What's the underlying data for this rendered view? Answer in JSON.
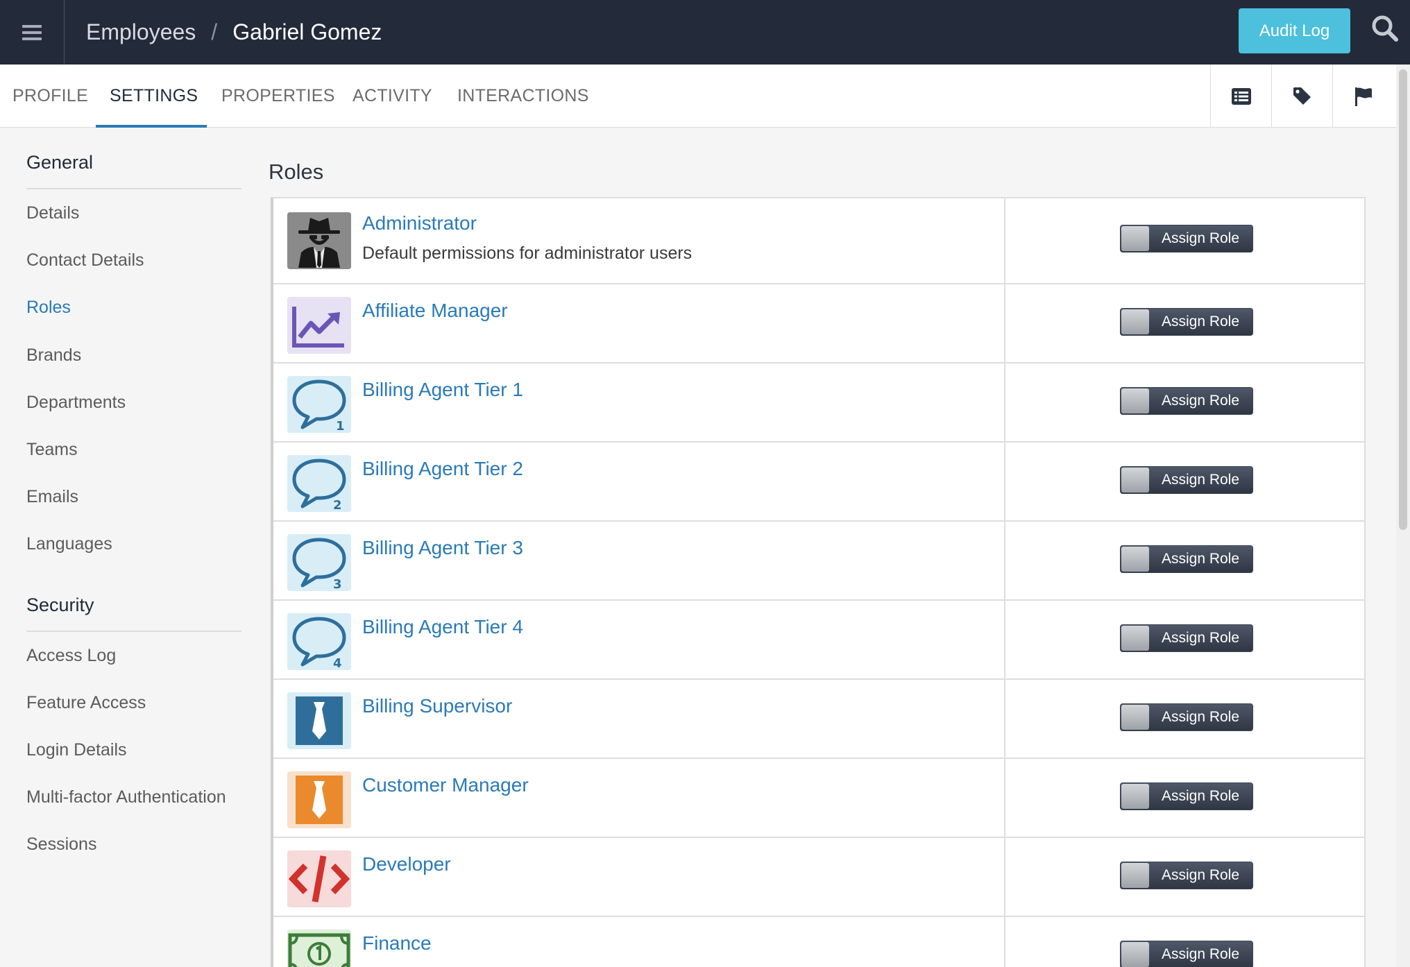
{
  "header": {
    "breadcrumb_parent": "Employees",
    "breadcrumb_separator": "/",
    "breadcrumb_current": "Gabriel Gomez",
    "audit_log_label": "Audit Log"
  },
  "tabs": [
    "PROFILE",
    "SETTINGS",
    "PROPERTIES",
    "ACTIVITY",
    "INTERACTIONS"
  ],
  "active_tab": "SETTINGS",
  "sidebar": {
    "general_heading": "General",
    "general_items": [
      "Details",
      "Contact Details",
      "Roles",
      "Brands",
      "Departments",
      "Teams",
      "Emails",
      "Languages"
    ],
    "security_heading": "Security",
    "security_items": [
      "Access Log",
      "Feature Access",
      "Login Details",
      "Multi-factor Authentication",
      "Sessions"
    ],
    "active_item": "Roles"
  },
  "main": {
    "section_title": "Roles",
    "assign_label": "Assign Role",
    "roles": [
      {
        "name": "Administrator",
        "description": "Default permissions for administrator users",
        "icon": "spy-icon"
      },
      {
        "name": "Affiliate Manager",
        "description": "",
        "icon": "chart-line-icon"
      },
      {
        "name": "Billing Agent Tier 1",
        "description": "",
        "icon": "speech-bubble-icon",
        "badge": "1"
      },
      {
        "name": "Billing Agent Tier 2",
        "description": "",
        "icon": "speech-bubble-icon",
        "badge": "2"
      },
      {
        "name": "Billing Agent Tier 3",
        "description": "",
        "icon": "speech-bubble-icon",
        "badge": "3"
      },
      {
        "name": "Billing Agent Tier 4",
        "description": "",
        "icon": "speech-bubble-icon",
        "badge": "4"
      },
      {
        "name": "Billing Supervisor",
        "description": "",
        "icon": "tie-blue-icon"
      },
      {
        "name": "Customer Manager",
        "description": "",
        "icon": "tie-orange-icon"
      },
      {
        "name": "Developer",
        "description": "",
        "icon": "code-icon"
      },
      {
        "name": "Finance",
        "description": "",
        "icon": "money-icon"
      }
    ]
  },
  "colors": {
    "topbar": "#232b3a",
    "accent": "#2a7ab8",
    "audit_button": "#4cc0dc"
  }
}
